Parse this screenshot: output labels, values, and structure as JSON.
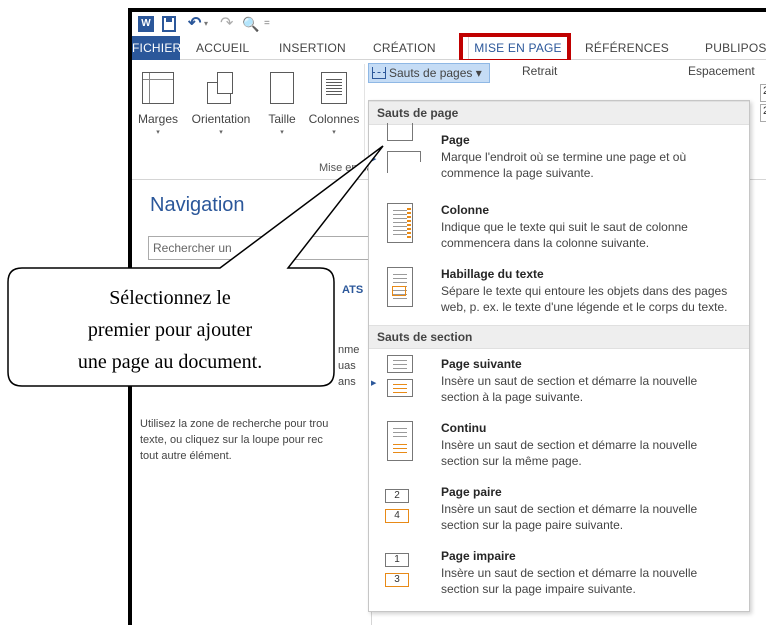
{
  "qat": {
    "word_glyph": "W",
    "undo_glyph": "↶",
    "undo_drop": "▾",
    "redo_glyph": "↷",
    "preview_glyph": "🔍",
    "more_glyph": "="
  },
  "tabs": [
    "FICHIER",
    "ACCUEIL",
    "INSERTION",
    "CRÉATION",
    "MISE EN PAGE",
    "RÉFÉRENCES",
    "PUBLIPOS"
  ],
  "ribbon": {
    "buttons": [
      "Marges",
      "Orientation",
      "Taille",
      "Colonnes"
    ],
    "caret": "▾",
    "group_label": "Mise en page",
    "sauts_label": "Sauts de pages ▾",
    "retrait_label": "Retrait",
    "espacement_label": "Espacement",
    "right_box_1": "2",
    "right_box_2": "2"
  },
  "navigation": {
    "title": "Navigation",
    "search_placeholder": "Rechercher un",
    "tab_fragment": "ATS",
    "frag_lines": [
      "nme",
      "uas",
      "ans"
    ],
    "help_lines": [
      "Utilisez la zone de recherche pour trou",
      "texte, ou cliquez sur la loupe pour rec",
      "tout autre élément."
    ]
  },
  "menu": {
    "section_1": "Sauts de page",
    "section_2": "Sauts de section",
    "arrow_glyph": "▶",
    "items": [
      {
        "title": "Page",
        "desc": [
          "Marque l'endroit où se termine une page et où",
          "commence la page suivante."
        ]
      },
      {
        "title": "Colonne",
        "desc": [
          "Indique que le texte qui suit le saut de colonne",
          "commencera dans la colonne suivante."
        ]
      },
      {
        "title": "Habillage du texte",
        "desc": [
          "Sépare le texte qui entoure les objets dans des pages",
          "web, p. ex. le texte d'une légende et le corps du texte."
        ]
      },
      {
        "title": "Page suivante",
        "desc": [
          "Insère un saut de section et démarre la nouvelle",
          "section à la page suivante."
        ]
      },
      {
        "title": "Continu",
        "desc": [
          "Insère un saut de section et démarre la nouvelle",
          "section sur la même page."
        ]
      },
      {
        "title": "Page paire",
        "desc": [
          "Insère un saut de section et démarre la nouvelle",
          "section sur la page paire suivante."
        ]
      },
      {
        "title": "Page impaire",
        "desc": [
          "Insère un saut de section et démarre la nouvelle",
          "section sur la page impaire suivante."
        ]
      }
    ],
    "page_paire_nums": [
      "2",
      "4"
    ],
    "page_impaire_nums": [
      "1",
      "3"
    ]
  },
  "callout": {
    "lines": [
      "Sélectionnez le",
      "premier pour ajouter",
      "une page au document."
    ]
  },
  "colors": {
    "accent": "#2b579a",
    "highlight_box": "#c00000",
    "icon_orange": "#e88a17"
  }
}
